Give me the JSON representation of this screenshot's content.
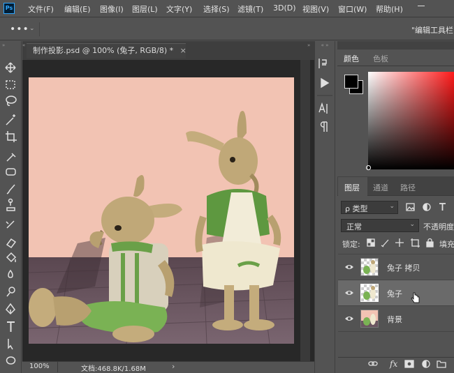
{
  "app": {
    "logo": "Ps"
  },
  "menu": [
    "文件(F)",
    "编辑(E)",
    "图像(I)",
    "图层(L)",
    "文字(Y)",
    "选择(S)",
    "滤镜(T)",
    "3D(D)",
    "视图(V)",
    "窗口(W)",
    "帮助(H)"
  ],
  "options": {
    "more": "•••",
    "right_text": "\"编辑工具栏"
  },
  "document": {
    "tab_title": "制作投影.psd @ 100% (兔子, RGB/8) *",
    "close": "×"
  },
  "status": {
    "zoom": "100%",
    "doc_info": "文档:468.8K/1.68M",
    "arrow": "›"
  },
  "color_panel": {
    "tabs": [
      "颜色",
      "色板"
    ],
    "accent": "#ff1a1a"
  },
  "layers_panel": {
    "tabs": [
      "图层",
      "通道",
      "路径"
    ],
    "filter_label": "ρ 类型",
    "blend_mode": "正常",
    "opacity_label": "不透明度",
    "lock_label": "锁定:",
    "fill_label": "填充",
    "layers": [
      {
        "name": "兔子 拷贝",
        "selected": false
      },
      {
        "name": "兔子",
        "selected": true
      },
      {
        "name": "背景",
        "selected": false
      }
    ],
    "bottom_fx": "fx"
  },
  "midstrip_icons": [
    "history-icon",
    "play-icon",
    "character-icon",
    "paragraph-icon"
  ]
}
